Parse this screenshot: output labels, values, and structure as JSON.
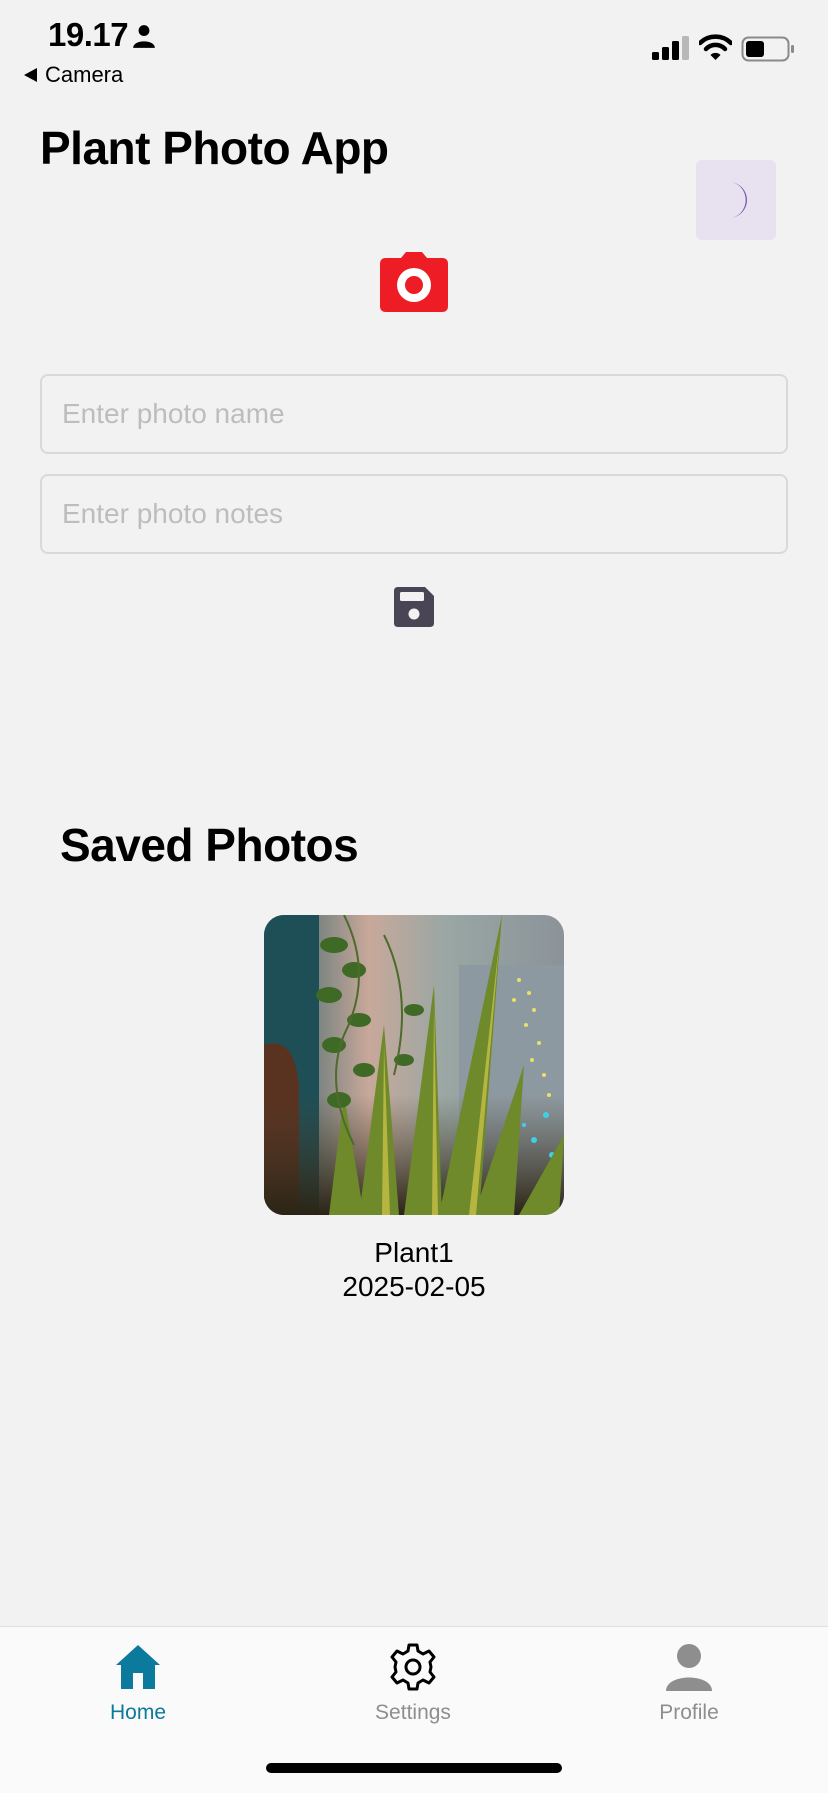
{
  "status_bar": {
    "time": "19.17",
    "back_label": "Camera"
  },
  "header": {
    "title": "Plant Photo App",
    "theme_toggle_icon": "moon-icon"
  },
  "form": {
    "camera_icon": "camera-icon",
    "name_placeholder": "Enter photo name",
    "notes_placeholder": "Enter photo notes",
    "save_icon": "floppy-disk-icon"
  },
  "saved": {
    "title": "Saved Photos",
    "photos": [
      {
        "name": "Plant1",
        "date": "2025-02-05"
      }
    ]
  },
  "tabs": [
    {
      "label": "Home",
      "icon": "home-icon",
      "active": true
    },
    {
      "label": "Settings",
      "icon": "gear-icon",
      "active": false
    },
    {
      "label": "Profile",
      "icon": "person-icon",
      "active": false
    }
  ],
  "colors": {
    "background": "#f2f2f2",
    "accent": "#0c7a9c",
    "camera": "#ee1c24",
    "theme_toggle_bg": "#e8e1ef",
    "moon": "#6f52ad",
    "inactive_tab": "#8e8e8e"
  }
}
